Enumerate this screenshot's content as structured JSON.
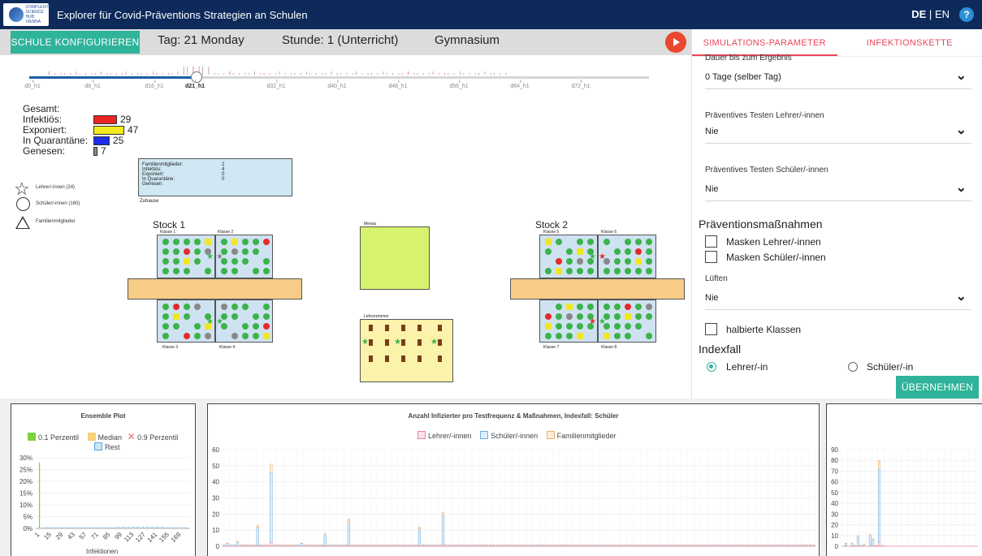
{
  "header": {
    "app_title": "Explorer für Covid-Präventions Strategien an Schulen",
    "logo_text": "COMPLEXITY SCIENCE HUB VIENNA",
    "lang_de": "DE",
    "lang_sep": "|",
    "lang_en": "EN",
    "help": "?"
  },
  "toolbar": {
    "configure_label": "SCHULE KONFIGURIEREN",
    "day": "Tag: 21 Monday",
    "hour": "Stunde: 1 (Unterricht)",
    "school_type": "Gymnasium"
  },
  "timeline": {
    "ticks": [
      "d0_h1",
      "d8_h1",
      "d16_h1",
      "d21_h1",
      "d32_h1",
      "d40_h1",
      "d48_h1",
      "d56_h1",
      "d64_h1",
      "d72_h1"
    ],
    "selected": "d21_h1",
    "progress": 0.27
  },
  "stats": {
    "total_label": "Gesamt:",
    "rows": [
      {
        "label": "Infektiös:",
        "value": "29",
        "color": "#e82424"
      },
      {
        "label": "Exponiert:",
        "value": "47",
        "color": "#f3ea1d"
      },
      {
        "label": "In Quarantäne:",
        "value": "25",
        "color": "#1d2ee8"
      },
      {
        "label": "Genesen:",
        "value": "7",
        "color": "#888888"
      }
    ]
  },
  "legend": {
    "teachers": "Lehrer/-innen (24)",
    "students": "Schüler/-innen (160)",
    "family": "Familienmitglieder"
  },
  "home": {
    "lines": [
      "Familienmitglieder:",
      "Infektiös:",
      "Exponiert:",
      "In Quarantäne:",
      "Genesen:"
    ],
    "values": [
      "",
      "2",
      "4",
      "0",
      "0"
    ],
    "caption": "Zuhause"
  },
  "floors": {
    "floor1": "Stock 1",
    "floor2": "Stock 2",
    "rooms": [
      "Klasse 1",
      "Klasse 2",
      "Klasse 3",
      "Klasse 4",
      "Klasse 5",
      "Klasse 6",
      "Klasse 7",
      "Klasse 8"
    ],
    "mensa": "Mensa",
    "staff_room": "Lehrerzimmer"
  },
  "panel": {
    "tabs": [
      "SIMULATIONS-PARAMETER",
      "INFEKTIONSKETTE"
    ],
    "result_label": "Dauer bis zum Ergebnis",
    "result_value": "0 Tage (selber Tag)",
    "test_teachers_label": "Präventives Testen Lehrer/-innen",
    "test_teachers_value": "Nie",
    "test_students_label": "Präventives Testen Schüler/-innen",
    "test_students_value": "Nie",
    "measures_title": "Präventionsmaßnahmen",
    "mask_teachers": "Masken Lehrer/-innen",
    "mask_students": "Masken Schüler/-innen",
    "ventilation_label": "Lüften",
    "ventilation_value": "Nie",
    "half_classes": "halbierte Klassen",
    "index_title": "Indexfall",
    "index_teacher": "Lehrer/-in",
    "index_student": "Schüler/-in",
    "apply_label": "ÜBERNEHMEN"
  },
  "chart_data": [
    {
      "type": "bar",
      "title": "Ensemble Plot",
      "legend": [
        "0.1 Perzentil",
        "Median",
        "0.9 Perzentil",
        "Rest"
      ],
      "colors": {
        "p01": "#7ad33a",
        "median": "#f5d27a",
        "p09": "#e86a6a",
        "rest": "#8fc6ea"
      },
      "xlabel": "Infektionen",
      "x_ticks": [
        "1",
        "15",
        "29",
        "43",
        "57",
        "71",
        "85",
        "99",
        "113",
        "127",
        "141",
        "155",
        "169"
      ],
      "y_ticks": [
        "0%",
        "5%",
        "10%",
        "15%",
        "20%",
        "25%",
        "30%"
      ],
      "ylim": [
        0,
        30
      ],
      "peak": {
        "x": 1,
        "value": 28
      },
      "rest_level": 0.5
    },
    {
      "type": "bar",
      "title": "Anzahl Infizierter pro Testfrequenz & Maßnahmen, Indexfall: Schüler",
      "series": [
        {
          "name": "Lehrer/-innen",
          "color": "#f3b6c2"
        },
        {
          "name": "Schüler/-innen",
          "color": "#b7d8f3"
        },
        {
          "name": "Familienmitglieder",
          "color": "#f8d3a8"
        }
      ],
      "y_ticks": [
        "0",
        "10",
        "20",
        "30",
        "40",
        "50",
        "60"
      ],
      "ylim": [
        0,
        60
      ],
      "values": [
        1,
        2,
        1,
        1,
        3,
        1,
        1,
        1,
        1,
        1,
        13,
        1,
        1,
        1,
        51,
        1,
        1,
        1,
        1,
        1,
        1,
        1,
        1,
        2,
        1,
        1,
        1,
        1,
        1,
        1,
        8,
        1,
        1,
        1,
        1,
        1,
        1,
        17,
        1,
        1,
        1,
        1,
        1,
        1,
        1,
        1,
        1,
        1,
        1,
        1,
        1,
        1,
        1,
        1,
        1,
        1,
        1,
        1,
        12,
        1,
        1,
        1,
        1,
        1,
        1,
        21,
        1,
        1,
        1,
        1,
        1,
        1,
        1,
        1,
        1,
        1,
        1,
        1,
        1,
        1,
        1,
        1,
        1,
        1,
        1,
        1,
        1,
        1,
        1,
        1,
        1,
        1,
        1,
        1,
        1,
        1,
        1,
        1,
        1,
        1,
        1,
        1,
        1,
        1,
        1,
        1,
        1,
        1,
        1,
        1,
        1,
        1,
        1,
        1,
        1,
        1,
        1,
        1,
        1,
        1,
        1,
        1,
        1,
        1,
        1,
        1,
        1,
        1,
        1,
        1,
        1,
        1,
        1,
        1,
        1,
        1,
        1,
        1,
        1,
        1,
        1,
        1,
        1,
        1,
        1,
        1,
        1,
        1,
        1,
        1,
        1,
        1,
        1,
        1,
        1,
        1,
        1,
        1,
        1,
        1,
        1,
        1,
        1,
        1,
        1,
        1,
        1,
        1,
        1,
        1,
        1,
        1,
        1,
        1,
        1,
        1
      ]
    },
    {
      "type": "bar",
      "y_ticks": [
        "0",
        "10",
        "20",
        "30",
        "40",
        "50",
        "60",
        "70",
        "80",
        "90"
      ],
      "ylim": [
        0,
        90
      ],
      "values": [
        0,
        3,
        0,
        3,
        1,
        10,
        1,
        2,
        0,
        11,
        7,
        1,
        80,
        1,
        0,
        0,
        0,
        0,
        0,
        0,
        0,
        0,
        0,
        0,
        0,
        0,
        0,
        0,
        0,
        0,
        0,
        0,
        0,
        0,
        0,
        0,
        0,
        0,
        0,
        0,
        0,
        0,
        0,
        0,
        0
      ]
    }
  ]
}
